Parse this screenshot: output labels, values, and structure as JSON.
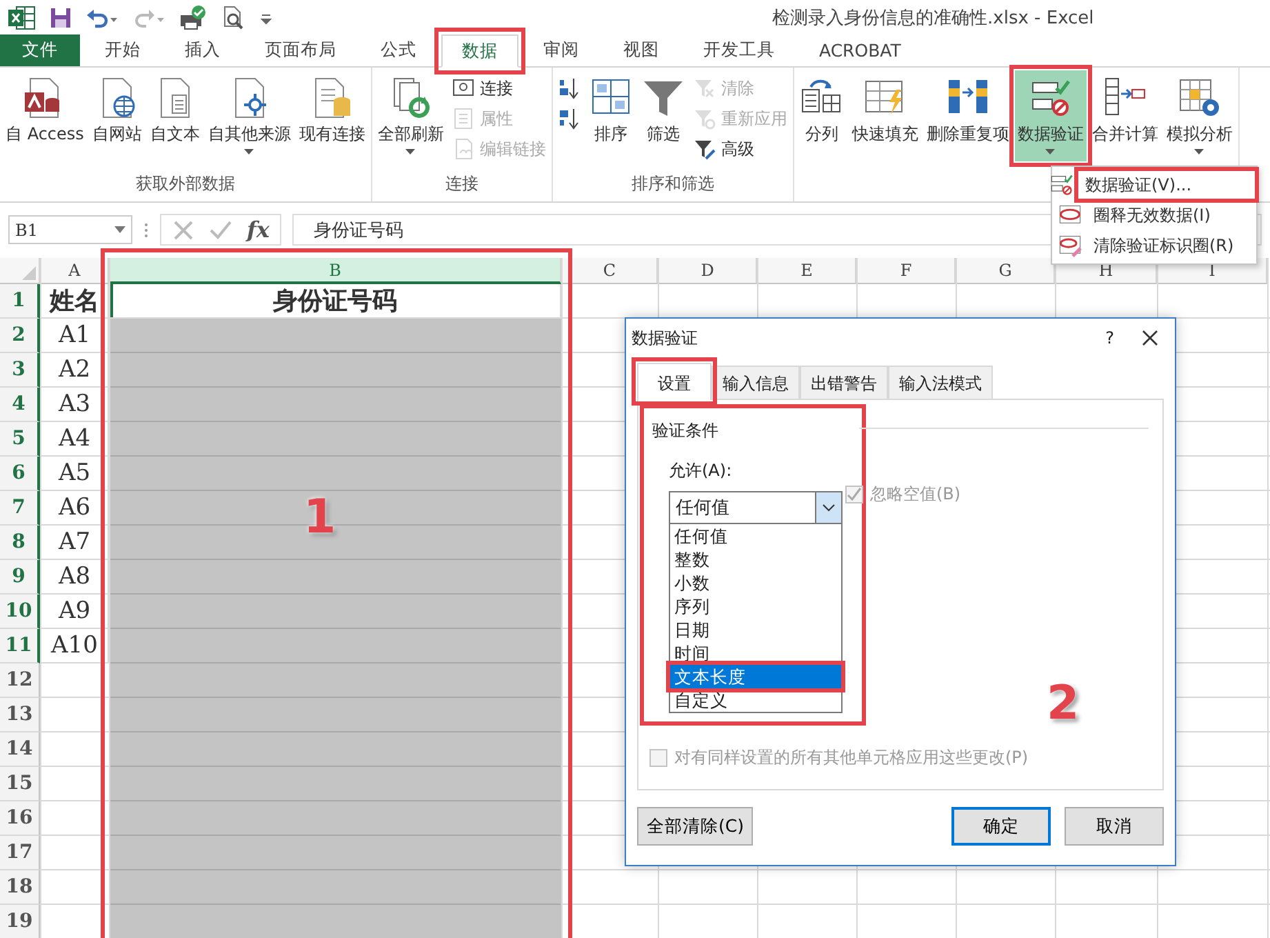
{
  "app": {
    "title": "检测录入身份信息的准确性.xlsx - Excel"
  },
  "ribbon_tabs": [
    {
      "label": "文件",
      "kind": "file",
      "selected": false,
      "highlighted": false
    },
    {
      "label": "开始",
      "kind": "tab",
      "selected": false,
      "highlighted": false
    },
    {
      "label": "插入",
      "kind": "tab",
      "selected": false,
      "highlighted": false
    },
    {
      "label": "页面布局",
      "kind": "tab",
      "selected": false,
      "highlighted": false
    },
    {
      "label": "公式",
      "kind": "tab",
      "selected": false,
      "highlighted": false
    },
    {
      "label": "数据",
      "kind": "tab",
      "selected": true,
      "highlighted": true
    },
    {
      "label": "审阅",
      "kind": "tab",
      "selected": false,
      "highlighted": false
    },
    {
      "label": "视图",
      "kind": "tab",
      "selected": false,
      "highlighted": false
    },
    {
      "label": "开发工具",
      "kind": "tab",
      "selected": false,
      "highlighted": false
    },
    {
      "label": "ACROBAT",
      "kind": "tab",
      "selected": false,
      "highlighted": false
    }
  ],
  "ribbon_groups": [
    {
      "label": "获取外部数据",
      "buttons": [
        {
          "label": "自 Access",
          "kind": "large",
          "disabled": false,
          "pressed": false,
          "highlighted": false
        },
        {
          "label": "自网站",
          "kind": "large",
          "disabled": false,
          "pressed": false,
          "highlighted": false
        },
        {
          "label": "自文本",
          "kind": "large",
          "disabled": false,
          "pressed": false,
          "highlighted": false
        },
        {
          "label": "自其他来源",
          "kind": "large_dropdown",
          "disabled": false,
          "pressed": false,
          "highlighted": false
        },
        {
          "label": "现有连接",
          "kind": "large",
          "disabled": false,
          "pressed": false,
          "highlighted": false
        }
      ]
    },
    {
      "label": "连接",
      "buttons": [
        {
          "label": "全部刷新",
          "kind": "large_dropdown",
          "disabled": false,
          "pressed": false,
          "highlighted": false
        },
        {
          "label": "连接",
          "kind": "small",
          "disabled": false,
          "pressed": false,
          "highlighted": false
        },
        {
          "label": "属性",
          "kind": "small",
          "disabled": true,
          "pressed": false,
          "highlighted": false
        },
        {
          "label": "编辑链接",
          "kind": "small",
          "disabled": true,
          "pressed": false,
          "highlighted": false
        }
      ]
    },
    {
      "label": "排序和筛选",
      "buttons": [
        {
          "kind": "icon_small",
          "disabled": false,
          "pressed": false,
          "highlighted": false
        },
        {
          "kind": "icon_small",
          "disabled": false,
          "pressed": false,
          "highlighted": false
        },
        {
          "label": "排序",
          "kind": "large",
          "disabled": false,
          "pressed": false,
          "highlighted": false
        },
        {
          "label": "筛选",
          "kind": "large",
          "disabled": false,
          "pressed": false,
          "highlighted": false
        },
        {
          "label": "清除",
          "kind": "small",
          "disabled": true,
          "pressed": false,
          "highlighted": false
        },
        {
          "label": "重新应用",
          "kind": "small",
          "disabled": true,
          "pressed": false,
          "highlighted": false
        },
        {
          "label": "高级",
          "kind": "small",
          "disabled": false,
          "pressed": false,
          "highlighted": false
        }
      ]
    },
    {
      "buttons": [
        {
          "label": "分列",
          "kind": "large",
          "disabled": false,
          "pressed": false,
          "highlighted": false
        },
        {
          "label": "快速填充",
          "kind": "large",
          "disabled": false,
          "pressed": false,
          "highlighted": false
        },
        {
          "label": "删除重复项",
          "kind": "large",
          "disabled": false,
          "pressed": false,
          "highlighted": false
        },
        {
          "label": "数据验证",
          "kind": "large_dropdown",
          "disabled": false,
          "pressed": true,
          "highlighted": true
        },
        {
          "label": "合并计算",
          "kind": "large",
          "disabled": false,
          "pressed": false,
          "highlighted": false
        },
        {
          "label": "模拟分析",
          "kind": "large_dropdown",
          "disabled": false,
          "pressed": false,
          "highlighted": false
        }
      ]
    }
  ],
  "menu": {
    "items": [
      {
        "label": "数据验证(V)...",
        "highlighted": true
      },
      {
        "label": "圈释无效数据(I)",
        "highlighted": false
      },
      {
        "label": "清除验证标识圈(R)",
        "highlighted": false
      }
    ]
  },
  "formula_bar": {
    "name_box": "B1",
    "function_button": "fx",
    "formula": "身份证号码"
  },
  "sheet": {
    "columns": [
      {
        "label": "A",
        "selected": false,
        "highlighted": false
      },
      {
        "label": "B",
        "selected": true,
        "highlighted": true,
        "annotation": "1"
      },
      {
        "label": "C",
        "selected": false,
        "highlighted": false
      },
      {
        "label": "D",
        "selected": false,
        "highlighted": false
      },
      {
        "label": "E",
        "selected": false,
        "highlighted": false
      },
      {
        "label": "F",
        "selected": false,
        "highlighted": false
      },
      {
        "label": "G",
        "selected": false,
        "highlighted": false
      },
      {
        "label": "H",
        "selected": false,
        "highlighted": false
      },
      {
        "label": "I",
        "selected": false,
        "highlighted": false
      }
    ],
    "rows": [
      {
        "number": "1",
        "selected": true,
        "shaded": false,
        "cells": [
          "姓名",
          "身份证号码"
        ]
      },
      {
        "number": "2",
        "selected": true,
        "shaded": true,
        "cells": [
          "A1"
        ]
      },
      {
        "number": "3",
        "selected": true,
        "shaded": true,
        "cells": [
          "A2"
        ]
      },
      {
        "number": "4",
        "selected": true,
        "shaded": true,
        "cells": [
          "A3"
        ]
      },
      {
        "number": "5",
        "selected": true,
        "shaded": true,
        "cells": [
          "A4"
        ]
      },
      {
        "number": "6",
        "selected": true,
        "shaded": true,
        "cells": [
          "A5"
        ]
      },
      {
        "number": "7",
        "selected": true,
        "shaded": true,
        "cells": [
          "A6"
        ]
      },
      {
        "number": "8",
        "selected": true,
        "shaded": true,
        "cells": [
          "A7"
        ]
      },
      {
        "number": "9",
        "selected": true,
        "shaded": true,
        "cells": [
          "A8"
        ]
      },
      {
        "number": "10",
        "selected": true,
        "shaded": true,
        "cells": [
          "A9"
        ]
      },
      {
        "number": "11",
        "selected": true,
        "shaded": true,
        "cells": [
          "A10"
        ]
      },
      {
        "number": "12",
        "selected": false,
        "shaded": true
      },
      {
        "number": "13",
        "selected": false,
        "shaded": true
      },
      {
        "number": "14",
        "selected": false,
        "shaded": true
      },
      {
        "number": "15",
        "selected": false,
        "shaded": true
      },
      {
        "number": "16",
        "selected": false,
        "shaded": true
      },
      {
        "number": "17",
        "selected": false,
        "shaded": true
      },
      {
        "number": "18",
        "selected": false,
        "shaded": true
      },
      {
        "number": "19",
        "selected": false,
        "shaded": true
      }
    ]
  },
  "dialog": {
    "title": "数据验证",
    "help": "?",
    "tabs": [
      {
        "label": "设置",
        "selected": true,
        "highlighted": true
      },
      {
        "label": "输入信息",
        "selected": false,
        "highlighted": false
      },
      {
        "label": "出错警告",
        "selected": false,
        "highlighted": false
      },
      {
        "label": "输入法模式",
        "selected": false,
        "highlighted": false
      }
    ],
    "group_label": "验证条件",
    "condition_highlighted": true,
    "allow_label": "允许(A):",
    "allow_value": "任何值",
    "allow_options": [
      {
        "label": "任何值",
        "selected": false,
        "highlighted": false
      },
      {
        "label": "整数",
        "selected": false,
        "highlighted": false
      },
      {
        "label": "小数",
        "selected": false,
        "highlighted": false
      },
      {
        "label": "序列",
        "selected": false,
        "highlighted": false
      },
      {
        "label": "日期",
        "selected": false,
        "highlighted": false
      },
      {
        "label": "时间",
        "selected": false,
        "highlighted": false
      },
      {
        "label": "文本长度",
        "selected": true,
        "highlighted": true
      },
      {
        "label": "自定义",
        "selected": false,
        "highlighted": false
      }
    ],
    "ignore_blank": {
      "label": "忽略空值(B)",
      "checked": true,
      "disabled": true
    },
    "apply_all": {
      "label": "对有同样设置的所有其他单元格应用这些更改(P)",
      "checked": false,
      "disabled": true
    },
    "buttons": [
      {
        "label": "全部清除(C)",
        "default": false
      },
      {
        "label": "确定",
        "default": true
      },
      {
        "label": "取消",
        "default": false
      }
    ],
    "annotation": "2"
  }
}
